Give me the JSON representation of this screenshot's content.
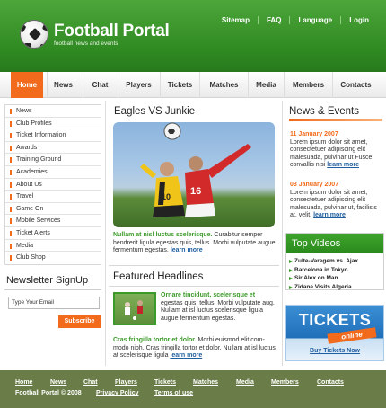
{
  "header": {
    "title": "Football Portal",
    "subtitle": "football news and  events",
    "topnav": [
      "Sitemap",
      "FAQ",
      "Language",
      "Login"
    ]
  },
  "mainnav": [
    "Home",
    "News",
    "Chat",
    "Players",
    "Tickets",
    "Matches",
    "Media",
    "Members",
    "Contacts"
  ],
  "sidebar": {
    "items": [
      "News",
      "Club Profiles",
      "Ticket Information",
      "Awards",
      "Training Ground",
      "Academies",
      "About Us",
      "Travel",
      "Game On",
      "Mobile Services",
      "Ticket Alerts",
      "Media",
      "Club Shop"
    ]
  },
  "newsletter": {
    "title": "Newsletter SignUp",
    "email_placeholder": "Type Your Email",
    "subscribe_label": "Subscribe"
  },
  "feature": {
    "title": "Eagles VS  Junkie",
    "lead": "Nullam at nisl luctus scelerisque.",
    "body": " Curabitur semper hendrerit ligula egestas quis, tellus. Morbi vulputate augue fermentum egestas.",
    "more": "learn more"
  },
  "headlines": {
    "title": "Featured Headlines",
    "item1_lead": "Ornare tincidunt, scelerisque et",
    "item1_body": " egestas quis, tellus. Morbi vulputate aug. Nullam at isl luctus scelerisque ligula augue fermentum egestas.",
    "item2_lead": "Cras fringilla tortor et dolor.",
    "item2_body": " Morbi euismod elit com-modo nibh. Cras fringilla tortor et dolor. Nullam at isl luctus at scelerisque ligula",
    "more": "learn more"
  },
  "news_events": {
    "title": "News & Events",
    "items": [
      {
        "date": "11 January 2007",
        "text": "Lorem ipsum dolor sit amet, consectetuer adipiscing elit malesuada, pulvinar ut Fusce convallis nisi",
        "more": "learn more"
      },
      {
        "date": "03 January 2007",
        "text": "Lorem ipsum dolor sit amet, consectetuer adipiscing elit malesuada, pulvinar ut, facilisis at, velit.",
        "more": "learn more"
      }
    ]
  },
  "top_videos": {
    "title": "Top Videos",
    "items": [
      "Zulte-Varegem vs. Ajax",
      "Barcelona in Tokyo",
      "Sir Alex on Man",
      "Zidane Visits Algeria"
    ]
  },
  "tickets_banner": {
    "headline": "TICKETS",
    "tag": "online",
    "link": "Buy Tickets Now"
  },
  "footer": {
    "links": [
      "Home",
      "News",
      "Chat",
      "Players",
      "Tickets",
      "Matches",
      "Media",
      "Members",
      "Contacts"
    ],
    "copyright": "Football Portal © 2008",
    "privacy": "Privacy Policy",
    "terms": "Terms of use"
  },
  "colors": {
    "brand_green": "#2f8a22",
    "accent_orange": "#f26a1b",
    "footer_olive": "#6a7c47",
    "link_blue": "#1f5f9f"
  }
}
